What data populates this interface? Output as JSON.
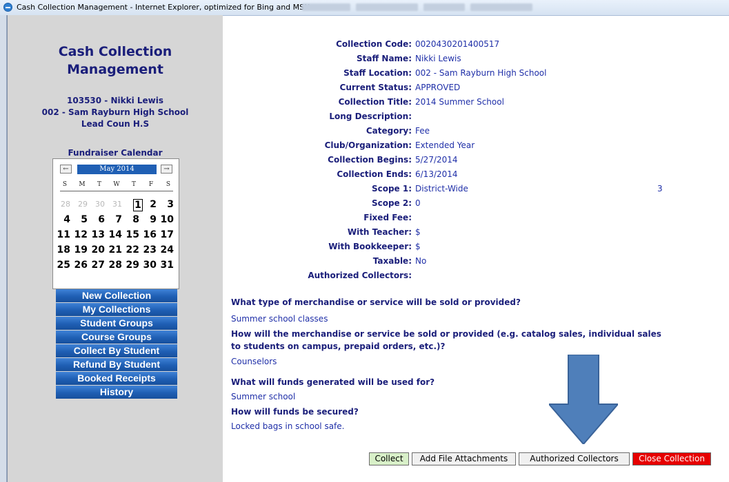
{
  "window": {
    "title": "Cash Collection Management - Internet Explorer, optimized for Bing and MSN"
  },
  "sidebar": {
    "app_title_line1": "Cash Collection",
    "app_title_line2": "Management",
    "user_line1": "103530 - Nikki Lewis",
    "user_line2": "002 - Sam Rayburn High School",
    "user_line3": "Lead Coun H.S",
    "calendar": {
      "title": "Fundraiser Calendar",
      "month": "May 2014",
      "prev_icon": "←",
      "next_icon": "→",
      "weekdays": [
        "S",
        "M",
        "T",
        "W",
        "T",
        "F",
        "S"
      ],
      "weeks": [
        [
          "28",
          "29",
          "30",
          "31",
          "1",
          "2",
          "3"
        ],
        [
          "4",
          "5",
          "6",
          "7",
          "8",
          "9",
          "10"
        ],
        [
          "11",
          "12",
          "13",
          "14",
          "15",
          "16",
          "17"
        ],
        [
          "18",
          "19",
          "20",
          "21",
          "22",
          "23",
          "24"
        ],
        [
          "25",
          "26",
          "27",
          "28",
          "29",
          "30",
          "31"
        ]
      ]
    },
    "menu": [
      "New Collection",
      "My Collections",
      "Student Groups",
      "Course Groups",
      "Collect By Student",
      "Refund By Student",
      "Booked Receipts",
      "History"
    ]
  },
  "details": [
    {
      "label": "Collection Code:",
      "value": "0020430201400517"
    },
    {
      "label": "Staff Name:",
      "value": "Nikki Lewis"
    },
    {
      "label": "Staff Location:",
      "value": "002 - Sam Rayburn High School"
    },
    {
      "label": "Current Status:",
      "value": "APPROVED"
    },
    {
      "label": "Collection Title:",
      "value": "2014 Summer School"
    },
    {
      "label": "Long Description:",
      "value": ""
    },
    {
      "label": "Category:",
      "value": "Fee"
    },
    {
      "label": "Club/Organization:",
      "value": "Extended Year"
    },
    {
      "label": "Collection Begins:",
      "value": "5/27/2014"
    },
    {
      "label": "Collection Ends:",
      "value": "6/13/2014"
    },
    {
      "label": "Scope 1:",
      "value": "District-Wide",
      "extra": "3"
    },
    {
      "label": "Scope 2:",
      "value": "0"
    },
    {
      "label": "Fixed Fee:",
      "value": ""
    },
    {
      "label": "With Teacher:",
      "value": "$"
    },
    {
      "label": "With Bookkeeper:",
      "value": "$"
    },
    {
      "label": "Taxable:",
      "value": "No"
    },
    {
      "label": "Authorized Collectors:",
      "value": ""
    }
  ],
  "questions": [
    {
      "q": "What type of merchandise or service will be sold or provided?",
      "a": "Summer school classes"
    },
    {
      "q": "How will the merchandise or service be sold or provided (e.g. catalog sales, individual sales to students on campus, prepaid orders, etc.)?",
      "a": "Counselors"
    },
    {
      "q": "What will funds generated will be used for?",
      "a": "Summer school"
    },
    {
      "q": "How will funds be secured?",
      "a": "Locked bags in school safe."
    }
  ],
  "buttons": {
    "collect": "Collect",
    "attachments": "Add File Attachments",
    "authorized": "Authorized Collectors",
    "close": "Close Collection"
  },
  "colors": {
    "label": "#1a1e7a",
    "value": "#1f2fa8",
    "nav": "#1f5fb4",
    "collect_btn": "#d8f0c8",
    "close_btn": "#e60000",
    "arrow": "#4f7fba"
  },
  "annotation": {
    "icon": "down-arrow-icon"
  }
}
